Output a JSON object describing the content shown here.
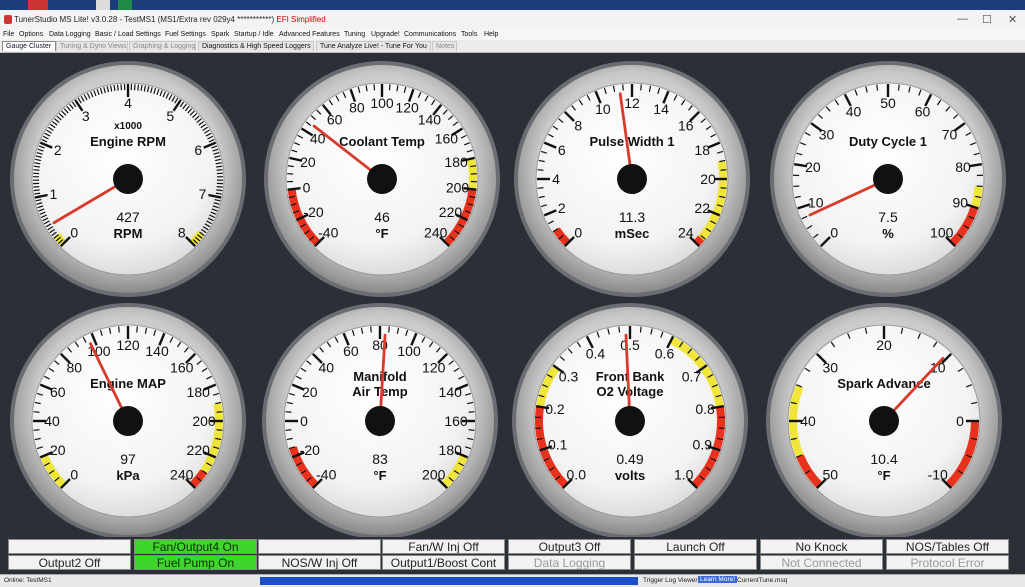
{
  "window": {
    "title_prefix": "TunerStudio MS Lite! v3.0.28 - TestMS1 (MS1/Extra rev 029y4 ***********)",
    "title_suffix": "EFI Simplified",
    "controls": [
      "—",
      "☐",
      "✕"
    ]
  },
  "menu": [
    "File",
    "Options",
    "Data Logging",
    "Basic / Load Settings",
    "Fuel Settings",
    "Spark",
    "Startup / Idle",
    "Advanced Features",
    "Tuning",
    "Upgrade!",
    "Communications",
    "Tools",
    "Help"
  ],
  "tabs": [
    {
      "label": "Gauge Cluster",
      "active": true
    },
    {
      "label": "Tuning & Dyno Views",
      "active": false
    },
    {
      "label": "Graphing & Logging",
      "active": false
    },
    {
      "label": "Diagnostics & High Speed Loggers",
      "active": false
    },
    {
      "label": "Tune Analyze Live! - Tune For You",
      "active": false
    },
    {
      "label": "Notes",
      "active": false
    }
  ],
  "gauges": [
    {
      "title": [
        "Engine RPM"
      ],
      "unit": "RPM",
      "scale": "x1000",
      "value_text": "427",
      "value": 0.427,
      "min": 0,
      "max": 8,
      "labels": [
        "0",
        "1",
        "2",
        "3",
        "4",
        "5",
        "6",
        "7",
        "8"
      ],
      "minor": 4,
      "warn_low": [
        0,
        0.2
      ],
      "warn_high": [
        7.75,
        8
      ],
      "crit_low": null,
      "crit_high": null
    },
    {
      "title": [
        "Coolant Temp"
      ],
      "unit": "°F",
      "value_text": "46",
      "value": 46,
      "min": -40,
      "max": 240,
      "labels": [
        "-40",
        "-20",
        "0",
        "20",
        "40",
        "60",
        "80",
        "100",
        "120",
        "140",
        "160",
        "180",
        "200",
        "220",
        "240"
      ],
      "minor": 1,
      "crit_low": [
        -40,
        0
      ],
      "warn_high": [
        180,
        200
      ],
      "crit_high": [
        200,
        240
      ]
    },
    {
      "title": [
        "Pulse Width 1"
      ],
      "unit": "mSec",
      "value_text": "11.3",
      "value": 11.3,
      "min": 0,
      "max": 24,
      "labels": [
        "0",
        "2",
        "4",
        "6",
        "8",
        "10",
        "12",
        "14",
        "16",
        "18",
        "20",
        "22",
        "24"
      ],
      "minor": 1,
      "crit_low": [
        0,
        1
      ],
      "warn_high": [
        19,
        24
      ],
      "crit_high": [
        23.6,
        24
      ]
    },
    {
      "title": [
        "Duty Cycle 1"
      ],
      "unit": "%",
      "value_text": "7.5",
      "value": 7.5,
      "min": 0,
      "max": 100,
      "labels": [
        "0",
        "10",
        "20",
        "30",
        "40",
        "50",
        "60",
        "70",
        "80",
        "90",
        "100"
      ],
      "minor": 1,
      "warn_high": [
        85,
        90
      ],
      "crit_high": [
        90,
        100
      ]
    },
    {
      "title": [
        "Engine MAP"
      ],
      "unit": "kPa",
      "value_text": "97",
      "value": 97,
      "min": 0,
      "max": 240,
      "labels": [
        "0",
        "20",
        "40",
        "60",
        "80",
        "100",
        "120",
        "140",
        "160",
        "180",
        "200",
        "220",
        "240"
      ],
      "minor": 1,
      "warn_low": [
        0,
        20
      ],
      "warn_high": [
        190,
        230
      ],
      "crit_high": [
        230,
        240
      ]
    },
    {
      "title": [
        "Manifold",
        "Air Temp"
      ],
      "unit": "°F",
      "value_text": "83",
      "value": 83,
      "min": -40,
      "max": 200,
      "labels": [
        "-40",
        "-20",
        "0",
        "20",
        "40",
        "60",
        "80",
        "100",
        "120",
        "140",
        "160",
        "180",
        "200"
      ],
      "minor": 1,
      "crit_low": [
        -40,
        -15
      ],
      "warn_high": [
        180,
        200
      ]
    },
    {
      "title": [
        "Front Bank",
        "O2 Voltage"
      ],
      "unit": "volts",
      "value_text": "0.49",
      "value": 0.49,
      "min": 0,
      "max": 1,
      "labels": [
        "0.0",
        "0.1",
        "0.2",
        "0.3",
        "0.4",
        "0.5",
        "0.6",
        "0.7",
        "0.8",
        "0.9",
        "1.0"
      ],
      "minor": 1,
      "crit_low": [
        0,
        0.2
      ],
      "warn_low": [
        0.2,
        0.3
      ],
      "warn_high": [
        0.6,
        0.8
      ],
      "crit_high": [
        0.8,
        1.0
      ]
    },
    {
      "title": [
        "Spark Advance"
      ],
      "unit": "°F",
      "value_text": "10.4",
      "value": 10.4,
      "min": 50,
      "max": -10,
      "labels": [
        "50",
        "40",
        "30",
        "20",
        "10",
        "0",
        "-10"
      ],
      "minor": 1,
      "crit_low": [
        50,
        45
      ],
      "warn_low": [
        45,
        35
      ],
      "crit_high": [
        0,
        -10
      ]
    }
  ],
  "indicators": [
    [
      {
        "label": "",
        "style": "blank"
      },
      {
        "label": "Output2 Off",
        "style": "normal"
      }
    ],
    [
      {
        "label": "Fan/Output4 On",
        "style": "green"
      },
      {
        "label": "Fuel Pump On",
        "style": "green"
      }
    ],
    [
      {
        "label": "",
        "style": "blank"
      },
      {
        "label": "NOS/W Inj Off",
        "style": "normal"
      }
    ],
    [
      {
        "label": "Fan/W Inj Off",
        "style": "normal"
      },
      {
        "label": "Output1/Boost Cont",
        "style": "normal"
      }
    ],
    [
      {
        "label": "Output3 Off",
        "style": "normal"
      },
      {
        "label": "Data Logging",
        "style": "dim"
      }
    ],
    [
      {
        "label": "Launch Off",
        "style": "normal"
      },
      {
        "label": "",
        "style": "blank"
      }
    ],
    [
      {
        "label": "No Knock",
        "style": "normal"
      },
      {
        "label": "Not Connected",
        "style": "dim"
      }
    ],
    [
      {
        "label": "NOS/Tables Off",
        "style": "normal"
      },
      {
        "label": "Protocol Error",
        "style": "dim"
      }
    ]
  ],
  "status": {
    "connection": "Online: TestMS1",
    "trigger": "Trigger Log Viewer",
    "learn": "Learn More!",
    "file": "CurrentTune.msq"
  },
  "colors": {
    "warn": "#f0e63a",
    "crit": "#e8321e",
    "needle": "#d83a2b",
    "green": "#3fd52b",
    "background": "#2b3036"
  }
}
